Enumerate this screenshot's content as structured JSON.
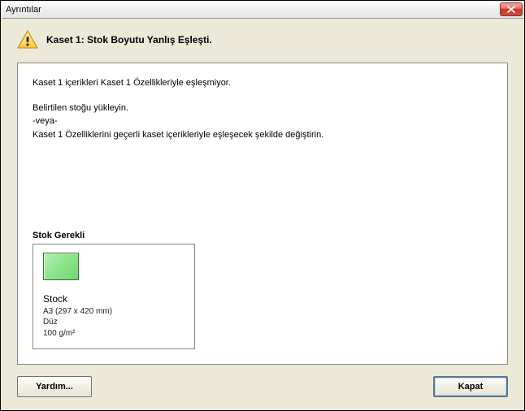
{
  "window": {
    "title": "Ayrıntılar"
  },
  "header": {
    "title": "Kaset 1: Stok Boyutu Yanlış Eşleşti."
  },
  "message": {
    "line1": "Kaset 1 içerikleri Kaset 1 Özellikleriyle eşleşmiyor.",
    "line2": "Belirtilen stoğu yükleyin.",
    "or": "-veya-",
    "line3": "Kaset 1 Özelliklerini geçerli kaset içerikleriyle eşleşecek şekilde değiştirin."
  },
  "stock": {
    "section_label": "Stok Gerekli",
    "name": "Stock",
    "size": "A3 (297 x 420 mm)",
    "type": "Düz",
    "weight": "100 g/m²",
    "swatch_color": "#8fe58f"
  },
  "buttons": {
    "help": "Yardım...",
    "close": "Kapat"
  }
}
